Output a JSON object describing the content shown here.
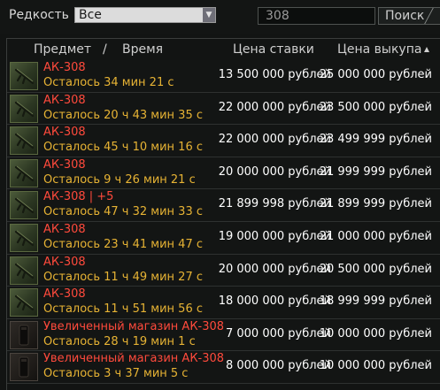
{
  "filter": {
    "rarity_label": "Редкость",
    "rarity_value": "Все",
    "search_value": "308",
    "search_button": "Поиск"
  },
  "header": {
    "item": "Предмет",
    "separator": "/",
    "time": "Время",
    "bid": "Цена ставки",
    "buyout": "Цена выкупа"
  },
  "rows": [
    {
      "name": "АК-308",
      "time": "Осталось 34 мин 21 с",
      "bid": "13 500 000 рублей",
      "buyout": "25 000 000 рублей",
      "icon": "rifle-icon"
    },
    {
      "name": "АК-308",
      "time": "Осталось 20 ч 43 мин 35 с",
      "bid": "22 000 000 рублей",
      "buyout": "23 500 000 рублей",
      "icon": "rifle-icon"
    },
    {
      "name": "АК-308",
      "time": "Осталось 45 ч 10 мин 16 с",
      "bid": "22 000 000 рублей",
      "buyout": "23 499 999 рублей",
      "icon": "rifle-icon"
    },
    {
      "name": "АК-308",
      "time": "Осталось 9 ч 26 мин 21 с",
      "bid": "20 000 000 рублей",
      "buyout": "21 999 999 рублей",
      "icon": "rifle-icon"
    },
    {
      "name": "АК-308 | +5",
      "time": "Осталось 47 ч 32 мин 33 с",
      "bid": "21 899 998 рублей",
      "buyout": "21 899 999 рублей",
      "icon": "rifle-icon"
    },
    {
      "name": "АК-308",
      "time": "Осталось 23 ч 41 мин 47 с",
      "bid": "19 000 000 рублей",
      "buyout": "21 000 000 рублей",
      "icon": "rifle-icon"
    },
    {
      "name": "АК-308",
      "time": "Осталось 11 ч 49 мин 27 с",
      "bid": "20 000 000 рублей",
      "buyout": "20 500 000 рублей",
      "icon": "rifle-icon"
    },
    {
      "name": "АК-308",
      "time": "Осталось 11 ч 51 мин 56 с",
      "bid": "18 000 000 рублей",
      "buyout": "18 999 999 рублей",
      "icon": "rifle-icon"
    },
    {
      "name": "Увеличенный магазин АК-308",
      "time": "Осталось 28 ч 19 мин 1 с",
      "bid": "7 000 000 рублей",
      "buyout": "10 000 000 рублей",
      "icon": "magazine-icon"
    },
    {
      "name": "Увеличенный магазин АК-308",
      "time": "Осталось 3 ч 37 мин 5 с",
      "bid": "8 000 000 рублей",
      "buyout": "10 000 000 рублей",
      "icon": "magazine-icon"
    }
  ],
  "colors": {
    "item_name": "#ff4a3c",
    "time_left": "#e7b334",
    "price": "#ffffff"
  }
}
